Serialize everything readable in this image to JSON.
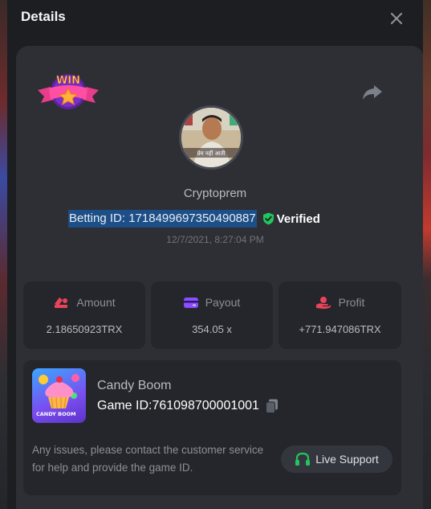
{
  "dialog": {
    "title": "Details",
    "badge_text": "WIN"
  },
  "avatar": {
    "caption": "प्रेम नहीं आती"
  },
  "bet": {
    "username": "Cryptoprem",
    "betting_id": "Betting ID: 1718499697350490887",
    "verified_label": "Verified",
    "timestamp": "12/7/2021, 8:27:04 PM"
  },
  "stats": [
    {
      "label": "Amount",
      "value": "2.18650923TRX",
      "icon": "coins-icon",
      "color": "#e8445a"
    },
    {
      "label": "Payout",
      "value": "354.05 x",
      "icon": "wallet-icon",
      "color": "#8a4dff"
    },
    {
      "label": "Profit",
      "value": "+771.947086TRX",
      "icon": "hand-coin-icon",
      "color": "#e8445a"
    }
  ],
  "game": {
    "name": "Candy Boom",
    "game_id": "Game ID:761098700001001",
    "thumb_text": "CANDY BOOM"
  },
  "support": {
    "help_text": "Any issues, please contact the customer service for help and provide the game ID.",
    "button_label": "Live Support"
  },
  "colors": {
    "accent_verified": "#22c55e",
    "highlight": "#1c4f88",
    "support_icon": "#22c55e"
  }
}
